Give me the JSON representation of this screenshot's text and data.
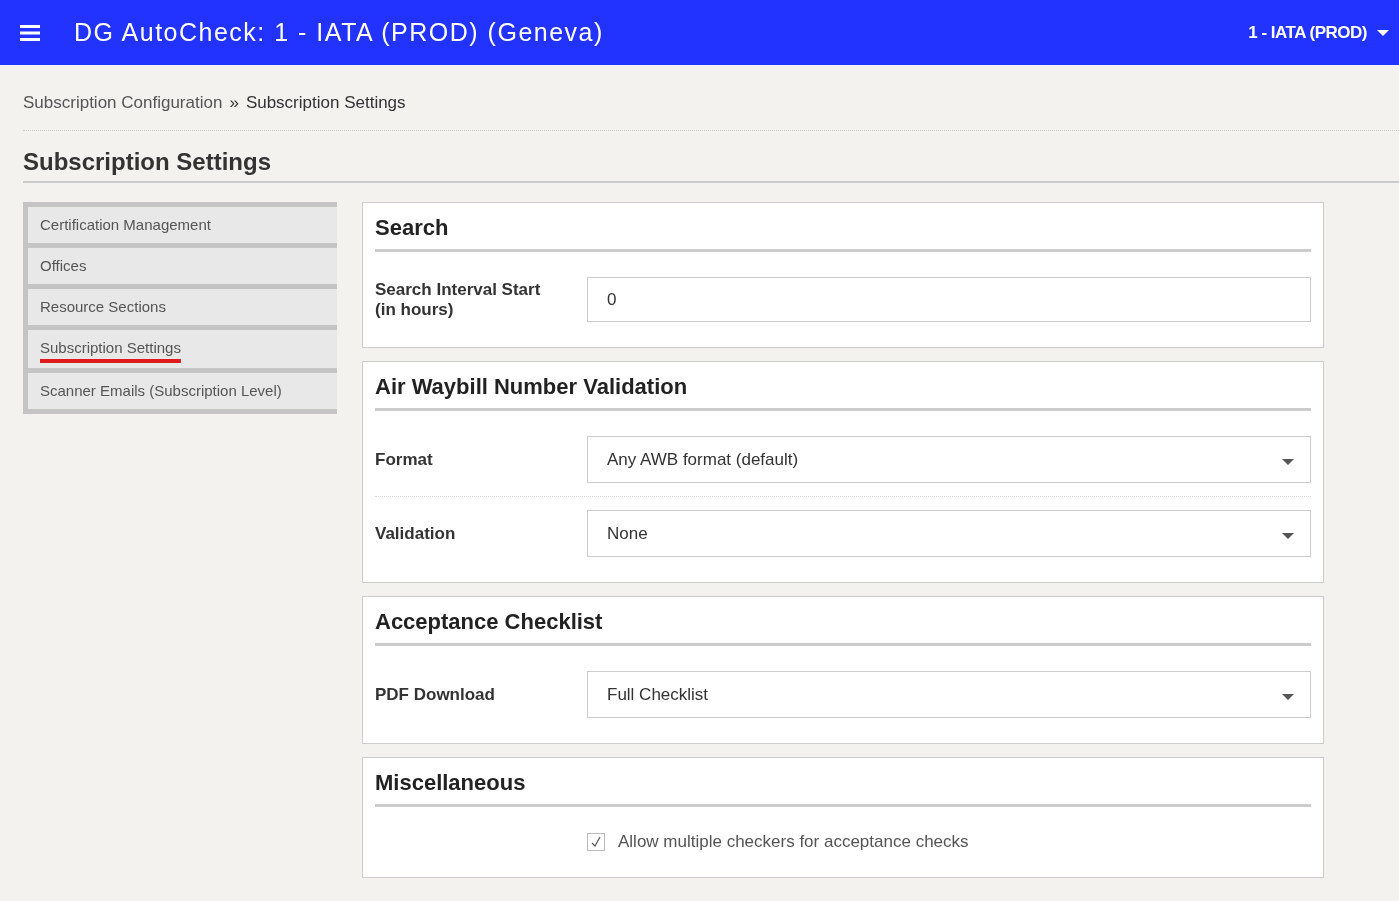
{
  "header": {
    "title": "DG AutoCheck: 1 - IATA (PROD) (Geneva)",
    "account": "1 - IATA (PROD)"
  },
  "breadcrumb": [
    {
      "label": "Subscription Configuration",
      "kind": "link"
    },
    {
      "label": "»",
      "kind": "separator"
    },
    {
      "label": "Subscription Settings",
      "kind": "current"
    }
  ],
  "page_title": "Subscription Settings",
  "sidebar": {
    "items": [
      {
        "label": "Certification Management",
        "selected": false
      },
      {
        "label": "Offices",
        "selected": false
      },
      {
        "label": "Resource Sections",
        "selected": false
      },
      {
        "label": "Subscription Settings",
        "selected": true
      },
      {
        "label": "Scanner Emails (Subscription Level)",
        "selected": false
      }
    ]
  },
  "sections": [
    {
      "title": "Search",
      "fields": [
        {
          "kind": "text",
          "label": "Search Interval Start (in hours)",
          "value": "0"
        }
      ]
    },
    {
      "title": "Air Waybill Number Validation",
      "fields": [
        {
          "kind": "select",
          "label": "Format",
          "value": "Any AWB format (default)"
        },
        {
          "kind": "select",
          "label": "Validation",
          "value": "None"
        }
      ]
    },
    {
      "title": "Acceptance Checklist",
      "fields": [
        {
          "kind": "select",
          "label": "PDF Download",
          "value": "Full Checklist"
        }
      ]
    },
    {
      "title": "Miscellaneous",
      "fields": [
        {
          "kind": "checkbox",
          "label": "Allow multiple checkers for acceptance checks",
          "checked": true
        }
      ]
    }
  ]
}
